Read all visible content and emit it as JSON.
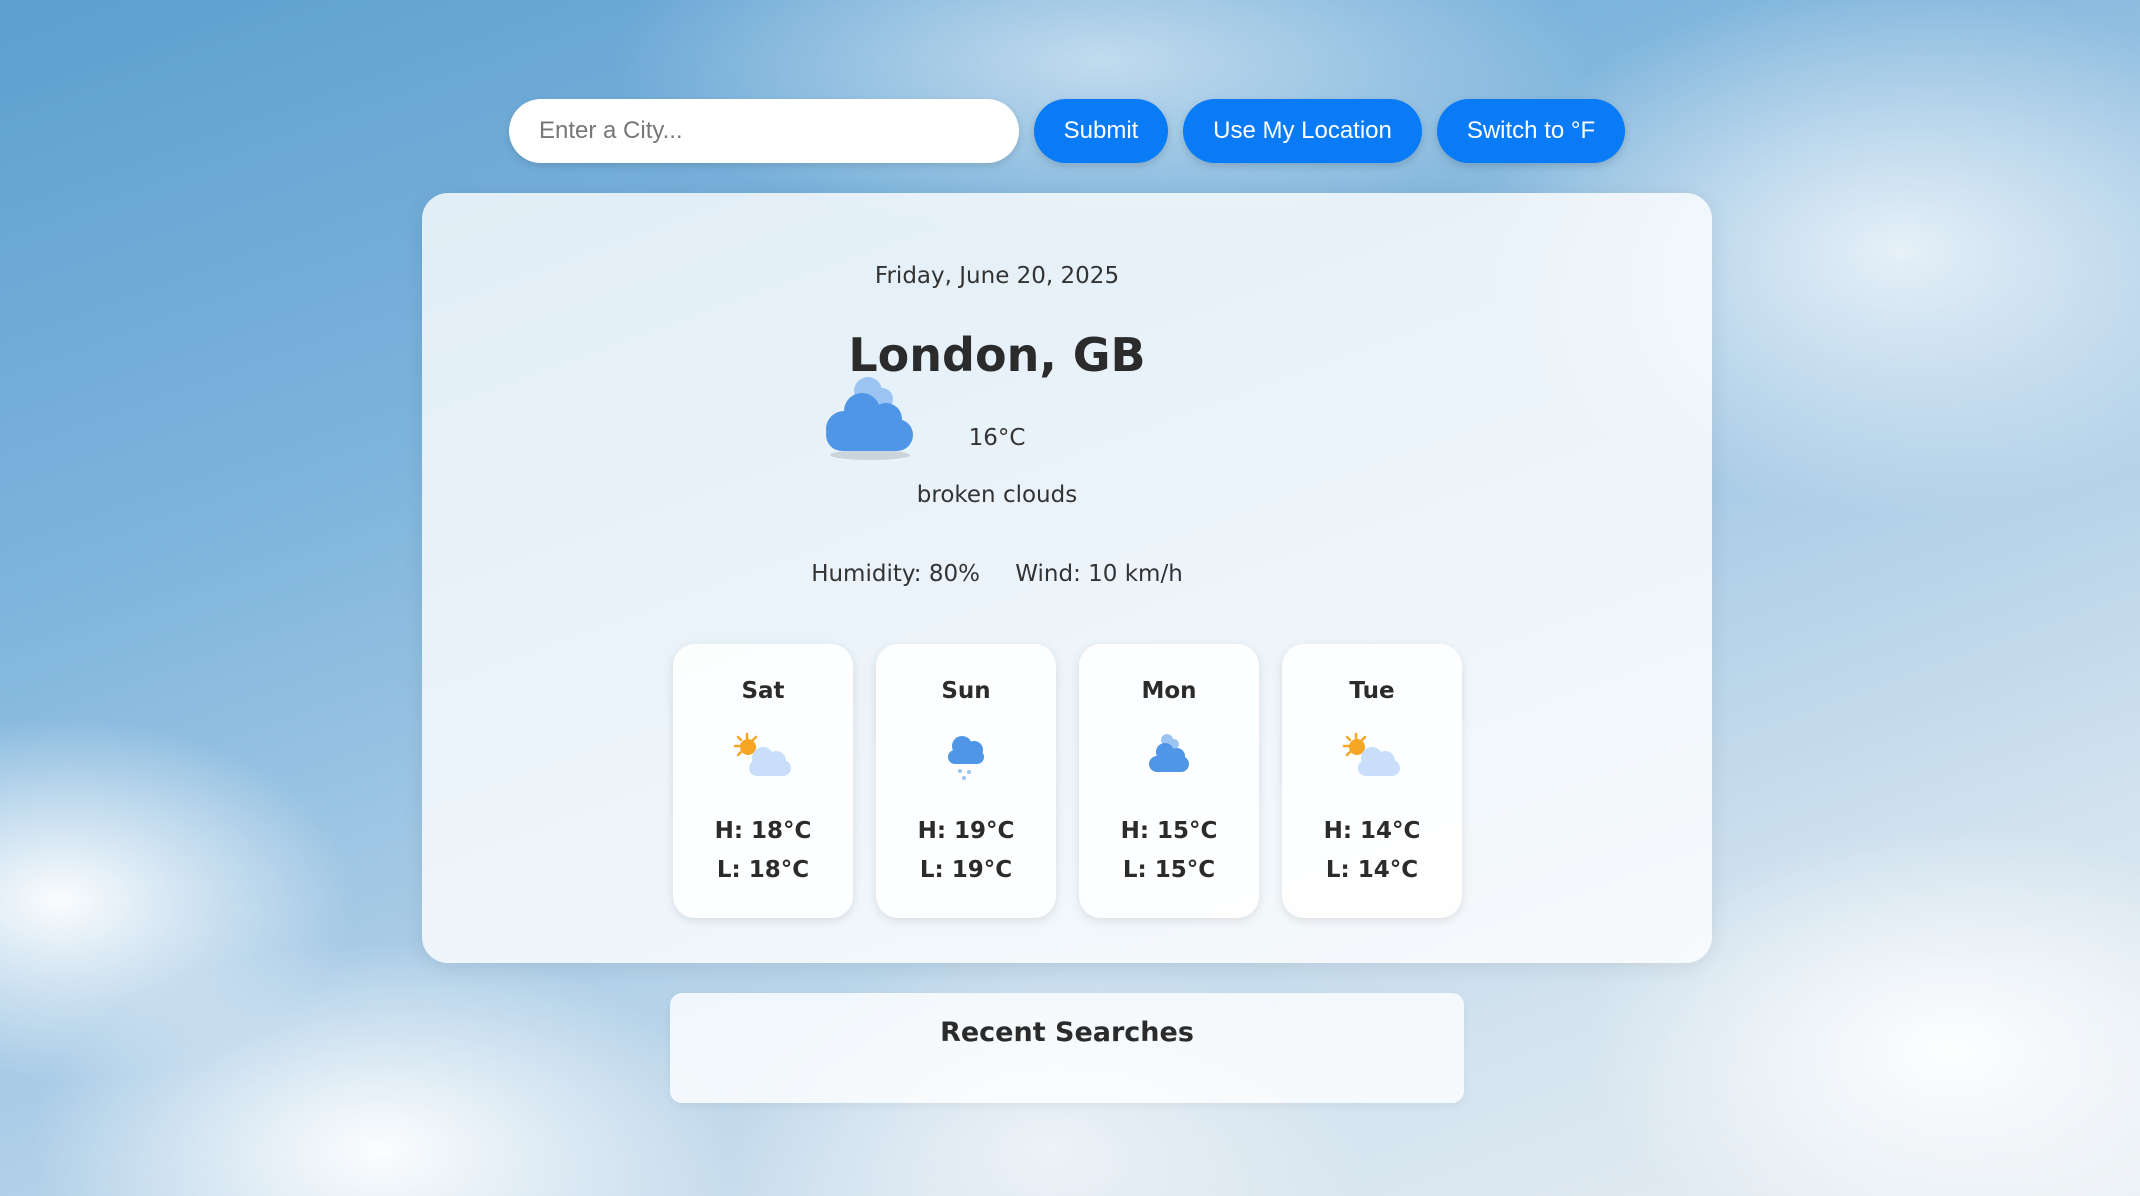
{
  "search": {
    "placeholder": "Enter a City...",
    "value": ""
  },
  "buttons": {
    "submit": "Submit",
    "use_location": "Use My Location",
    "switch_unit": "Switch to °F"
  },
  "current": {
    "date": "Friday, June 20, 2025",
    "city": "London, GB",
    "temperature": "16°C",
    "description": "broken clouds",
    "humidity": "Humidity: 80%",
    "wind": "Wind: 10 km/h",
    "icon": "broken-clouds-icon"
  },
  "forecast": [
    {
      "day": "Sat",
      "high": "H: 18°C",
      "low": "L: 18°C",
      "icon": "few-clouds-icon"
    },
    {
      "day": "Sun",
      "high": "H: 19°C",
      "low": "L: 19°C",
      "icon": "light-rain-icon"
    },
    {
      "day": "Mon",
      "high": "H: 15°C",
      "low": "L: 15°C",
      "icon": "broken-clouds-icon"
    },
    {
      "day": "Tue",
      "high": "H: 14°C",
      "low": "L: 14°C",
      "icon": "few-clouds-icon"
    }
  ],
  "recent": {
    "title": "Recent Searches",
    "items": []
  },
  "colors": {
    "accent": "#0a7bf7",
    "cloud_dark": "#4f97e6",
    "cloud_light": "#c9defa",
    "sun": "#f5a623"
  }
}
